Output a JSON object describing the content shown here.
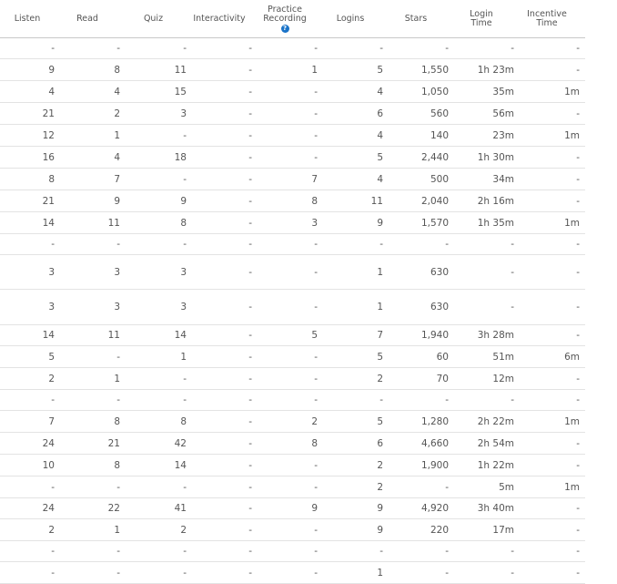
{
  "headers": {
    "listen": "Listen",
    "read": "Read",
    "quiz": "Quiz",
    "interactivity": "Interactivity",
    "practice_recording_line1": "Practice",
    "practice_recording_line2": "Recording",
    "help_icon_glyph": "?",
    "logins": "Logins",
    "stars": "Stars",
    "login_time_line1": "Login",
    "login_time_line2": "Time",
    "incentive_time_line1": "Incentive",
    "incentive_time_line2": "Time"
  },
  "rows": [
    [
      "-",
      "-",
      "-",
      "-",
      "-",
      "-",
      "-",
      "-",
      "-"
    ],
    [
      "9",
      "8",
      "11",
      "-",
      "1",
      "5",
      "1,550",
      "1h 23m",
      "-"
    ],
    [
      "4",
      "4",
      "15",
      "-",
      "-",
      "4",
      "1,050",
      "35m",
      "1m"
    ],
    [
      "21",
      "2",
      "3",
      "-",
      "-",
      "6",
      "560",
      "56m",
      "-"
    ],
    [
      "12",
      "1",
      "-",
      "-",
      "-",
      "4",
      "140",
      "23m",
      "1m"
    ],
    [
      "16",
      "4",
      "18",
      "-",
      "-",
      "5",
      "2,440",
      "1h 30m",
      "-"
    ],
    [
      "8",
      "7",
      "-",
      "-",
      "7",
      "4",
      "500",
      "34m",
      "-"
    ],
    [
      "21",
      "9",
      "9",
      "-",
      "8",
      "11",
      "2,040",
      "2h 16m",
      "-"
    ],
    [
      "14",
      "11",
      "8",
      "-",
      "3",
      "9",
      "1,570",
      "1h 35m",
      "1m"
    ],
    [
      "-",
      "-",
      "-",
      "-",
      "-",
      "-",
      "-",
      "-",
      "-"
    ],
    [
      "3",
      "3",
      "3",
      "-",
      "-",
      "1",
      "630",
      "-",
      "-"
    ],
    [
      "3",
      "3",
      "3",
      "-",
      "-",
      "1",
      "630",
      "-",
      "-"
    ],
    [
      "14",
      "11",
      "14",
      "-",
      "5",
      "7",
      "1,940",
      "3h 28m",
      "-"
    ],
    [
      "5",
      "-",
      "1",
      "-",
      "-",
      "5",
      "60",
      "51m",
      "6m"
    ],
    [
      "2",
      "1",
      "-",
      "-",
      "-",
      "2",
      "70",
      "12m",
      "-"
    ],
    [
      "-",
      "-",
      "-",
      "-",
      "-",
      "-",
      "-",
      "-",
      "-"
    ],
    [
      "7",
      "8",
      "8",
      "-",
      "2",
      "5",
      "1,280",
      "2h 22m",
      "1m"
    ],
    [
      "24",
      "21",
      "42",
      "-",
      "8",
      "6",
      "4,660",
      "2h 54m",
      "-"
    ],
    [
      "10",
      "8",
      "14",
      "-",
      "-",
      "2",
      "1,900",
      "1h 22m",
      "-"
    ],
    [
      "-",
      "-",
      "-",
      "-",
      "-",
      "2",
      "-",
      "5m",
      "1m"
    ],
    [
      "24",
      "22",
      "41",
      "-",
      "9",
      "9",
      "4,920",
      "3h 40m",
      "-"
    ],
    [
      "2",
      "1",
      "2",
      "-",
      "-",
      "9",
      "220",
      "17m",
      "-"
    ],
    [
      "-",
      "-",
      "-",
      "-",
      "-",
      "-",
      "-",
      "-",
      "-"
    ],
    [
      "-",
      "-",
      "-",
      "-",
      "-",
      "1",
      "-",
      "-",
      "-"
    ]
  ]
}
